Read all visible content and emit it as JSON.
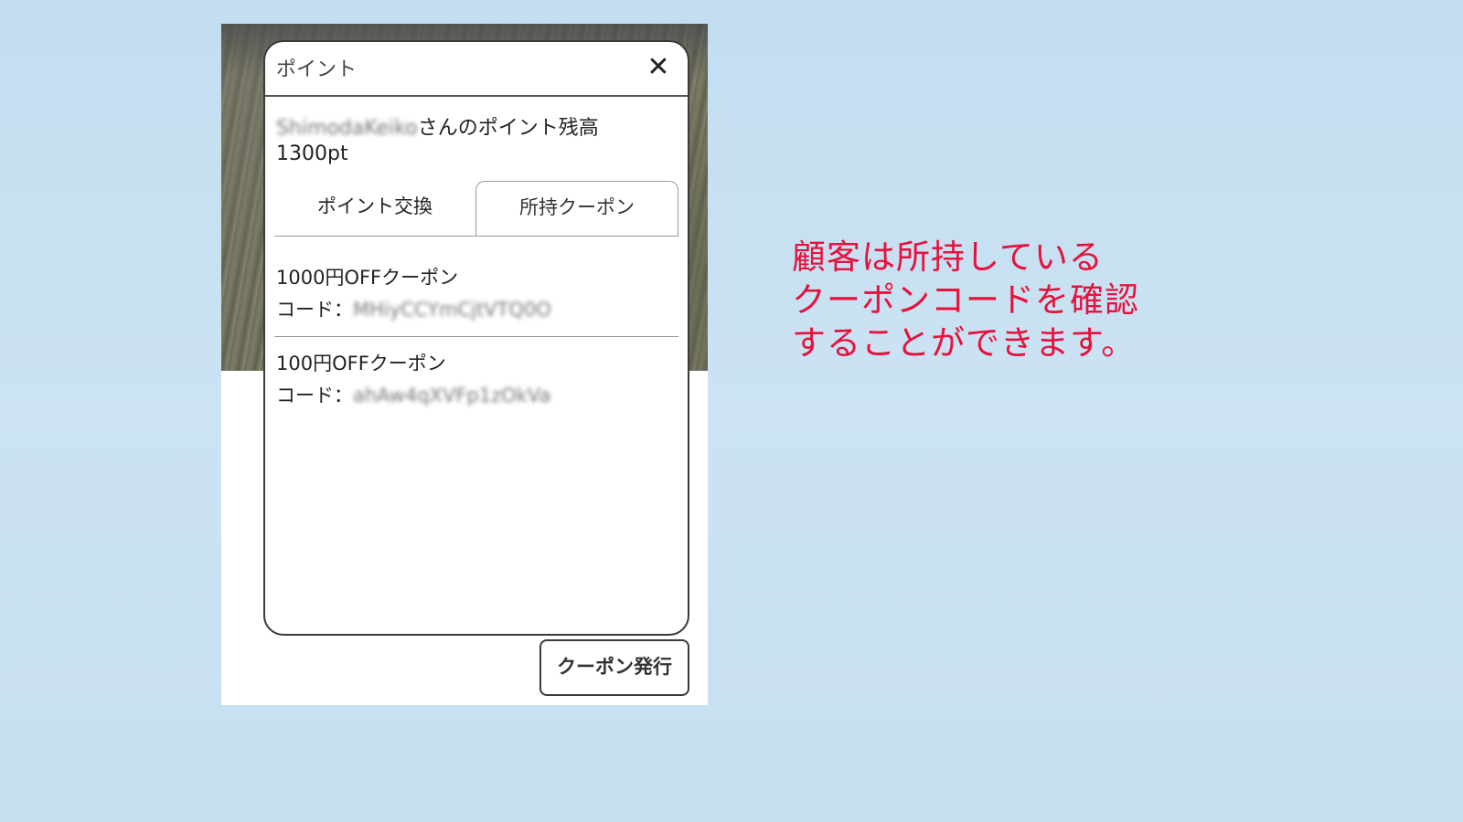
{
  "modal": {
    "title": "ポイント",
    "close_icon": "close-icon",
    "user_name_blurred": "ShimodaKeiko",
    "balance_suffix": "さんのポイント残高",
    "balance_value": "1300pt"
  },
  "tabs": [
    {
      "label": "ポイント交換",
      "active": false
    },
    {
      "label": "所持クーポン",
      "active": true
    }
  ],
  "coupons": [
    {
      "name": "1000円OFFクーポン",
      "code_label": "コード：",
      "code_blurred": "MHiyCCYmCjtVTQ0O"
    },
    {
      "name": "100円OFFクーポン",
      "code_label": "コード：",
      "code_blurred": "ahAw4qXVFp1zOkVa"
    }
  ],
  "issue_button_label": "クーポン発行",
  "caption": {
    "line1": "顧客は所持している",
    "line2": "クーポンコードを確認",
    "line3": "することができます。"
  },
  "colors": {
    "caption": "#e6123d",
    "page_background": "#c6dff1"
  }
}
